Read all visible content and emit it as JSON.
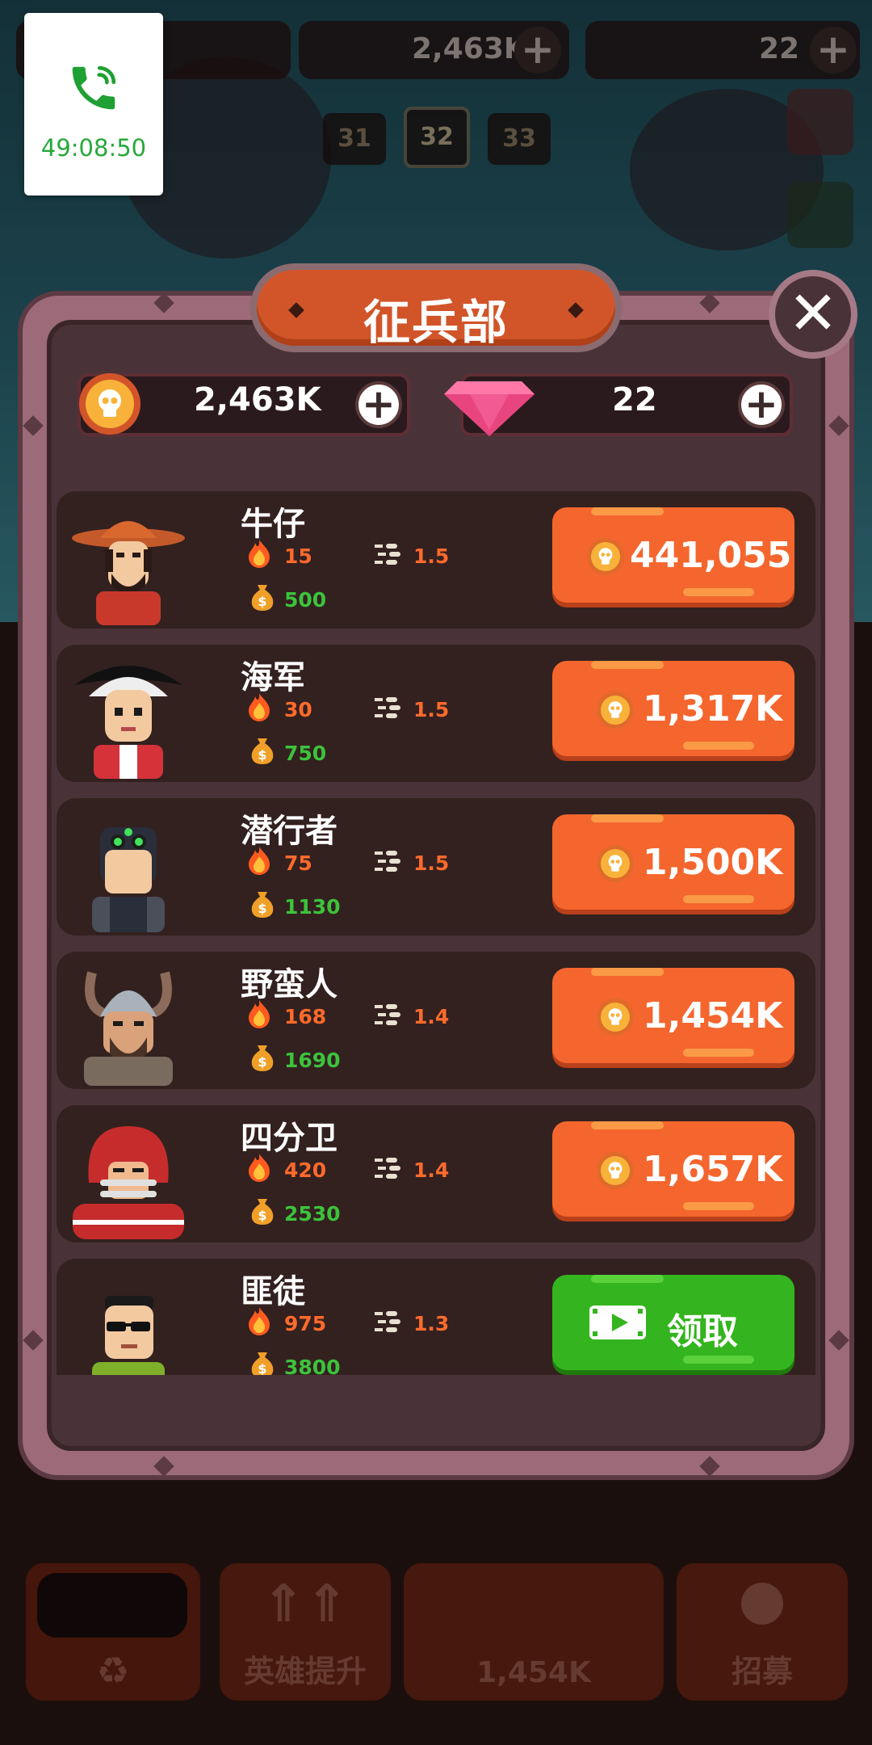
{
  "status_overlay": {
    "call_timer": "49:08:50",
    "icon": "phone-call-icon"
  },
  "hud": {
    "coins": "2,463K",
    "gems": "22",
    "levels": [
      "31",
      "32",
      "33"
    ],
    "current_level": "32"
  },
  "modal": {
    "title": "征兵部",
    "coins": "2,463K",
    "gems": "22",
    "colors": {
      "frame": "#9c6a78",
      "panel": "#4a3338",
      "buy": "#f4662e",
      "free": "#34b41e"
    }
  },
  "heroes": [
    {
      "name": "牛仔",
      "power": "15",
      "rate": "1.5",
      "income": "500",
      "price": "441,055",
      "action": "buy"
    },
    {
      "name": "海军",
      "power": "30",
      "rate": "1.5",
      "income": "750",
      "price": "1,317K",
      "action": "buy"
    },
    {
      "name": "潜行者",
      "power": "75",
      "rate": "1.5",
      "income": "1130",
      "price": "1,500K",
      "action": "buy"
    },
    {
      "name": "野蛮人",
      "power": "168",
      "rate": "1.4",
      "income": "1690",
      "price": "1,454K",
      "action": "buy"
    },
    {
      "name": "四分卫",
      "power": "420",
      "rate": "1.4",
      "income": "2530",
      "price": "1,657K",
      "action": "buy"
    },
    {
      "name": "匪徒",
      "power": "975",
      "rate": "1.3",
      "income": "3800",
      "price": "领取",
      "action": "watch-video"
    }
  ],
  "bottom_nav": {
    "upgrade_label": "英雄提升",
    "buy_price": "1,454K",
    "recruit_label": "招募"
  }
}
